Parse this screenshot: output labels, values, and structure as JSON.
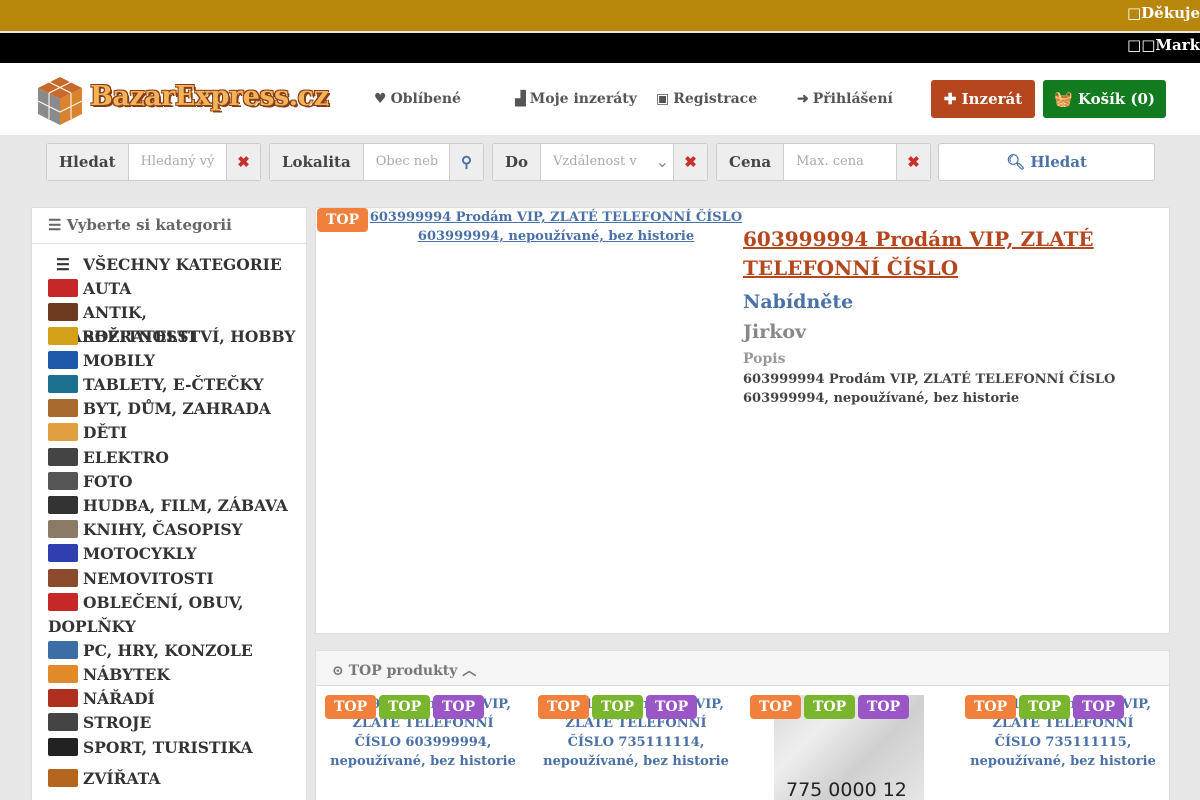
{
  "ticker": {
    "line1": "□Děkuje",
    "line2": "□□Mark"
  },
  "header": {
    "logo_text": "BazarExpress.cz",
    "nav": {
      "favorites": "Oblíbené",
      "my_ads": "Moje inzeráty",
      "register": "Registrace",
      "login": "Přihlášení"
    },
    "ad_button": "Inzerát",
    "cart_button": "Košík (0)",
    "colors": {
      "ad_button": "#b5461e",
      "cart_button": "#127b1f",
      "ticker1": "#b8860b",
      "ticker2": "#000000"
    }
  },
  "search": {
    "query": {
      "label": "Hledat",
      "placeholder": "Hledaný vý"
    },
    "location": {
      "label": "Lokalita",
      "placeholder": "Obec neb"
    },
    "distance": {
      "label": "Do",
      "placeholder": "Vzdálenost v"
    },
    "price": {
      "label": "Cena",
      "placeholder": "Max. cena"
    },
    "submit": "Hledat"
  },
  "sidebar": {
    "heading": "Vyberte si kategorii",
    "categories": [
      {
        "label": "VŠECHNY KATEGORIE",
        "icon": "list-icon"
      },
      {
        "label": "AUTA",
        "icon": "car-icon"
      },
      {
        "label": "ANTIK, STAROŽITNOSTI",
        "icon": "antique-chair-icon"
      },
      {
        "label": "SBĚRATELSTVÍ, HOBBY",
        "icon": "coins-icon"
      },
      {
        "label": "MOBILY",
        "icon": "mobile-icon"
      },
      {
        "label": "TABLETY, E-ČTEČKY",
        "icon": "tablet-icon"
      },
      {
        "label": "BYT, DŮM, ZAHRADA",
        "icon": "house-icon"
      },
      {
        "label": "DĚTI",
        "icon": "kids-icon"
      },
      {
        "label": "ELEKTRO",
        "icon": "radio-icon"
      },
      {
        "label": "FOTO",
        "icon": "camera-icon"
      },
      {
        "label": "HUDBA, FILM, ZÁBAVA",
        "icon": "piano-icon"
      },
      {
        "label": "KNIHY, ČASOPISY",
        "icon": "book-icon"
      },
      {
        "label": "MOTOCYKLY",
        "icon": "motorcycle-icon"
      },
      {
        "label": "NEMOVITOSTI",
        "icon": "building-icon"
      },
      {
        "label": "OBLEČENÍ, OBUV, DOPLŇKY",
        "icon": "shirt-icon"
      },
      {
        "label": "PC, HRY, KONZOLE",
        "icon": "computer-icon"
      },
      {
        "label": "NÁBYTEK",
        "icon": "sofa-icon"
      },
      {
        "label": "NÁŘADÍ",
        "icon": "drill-icon"
      },
      {
        "label": "STROJE",
        "icon": "machine-icon"
      },
      {
        "label": "SPORT, TURISTIKA",
        "icon": "football-icon"
      },
      {
        "label": "ZVÍŘATA",
        "icon": "animal-icon"
      }
    ]
  },
  "listing": {
    "badge": "TOP",
    "image_title": "603999994 Prodám VIP, ZLATÉ TELEFONNÍ ČÍSLO 603999994, nepoužívané, bez historie",
    "title": "603999994 Prodám VIP, ZLATÉ TELEFONNÍ ČÍSLO",
    "offer_type": "Nabídněte",
    "location": "Jirkov",
    "description_label": "Popis",
    "description": "603999994 Prodám VIP, ZLATÉ TELEFONNÍ ČÍSLO 603999994, nepoužívané, bez historie"
  },
  "top_products": {
    "heading": "TOP produkty",
    "badge": "TOP",
    "items": [
      {
        "title": "603999994 Prodám VIP, ZLATÉ TELEFONNÍ ČÍSLO 603999994, nepoužívané, bez historie"
      },
      {
        "title": "735111114 Prodám VIP, ZLATÉ TELEFONNÍ ČÍSLO 735111114, nepoužívané, bez historie"
      },
      {
        "image_number": "775 0000 12"
      },
      {
        "title": "735111115 Prodám VIP, ZLATÉ TELEFONNÍ ČÍSLO 735111115, nepoužívané, bez historie"
      }
    ]
  }
}
